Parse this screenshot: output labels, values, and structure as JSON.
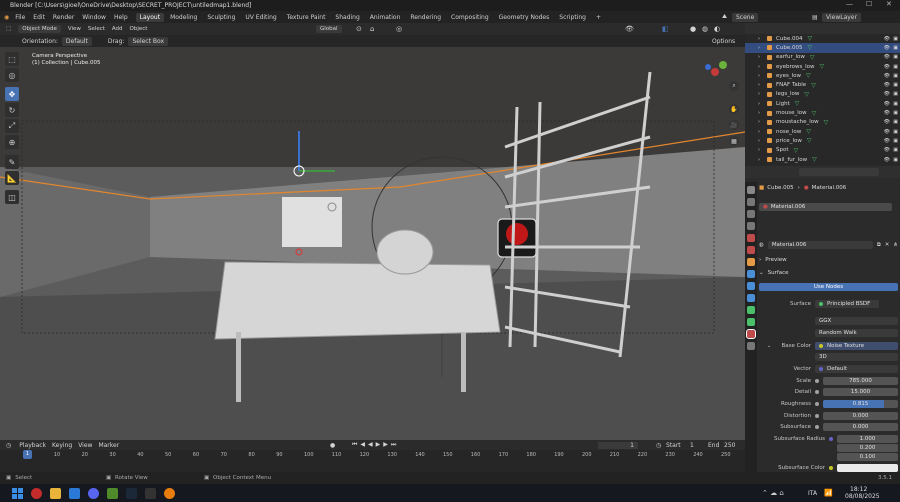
{
  "window": {
    "title": "Blender [C:\\Users\\gioel\\OneDrive\\Desktop\\SECRET_PROJECT\\untiledmap1.blend]",
    "minimize": "—",
    "maximize": "☐",
    "close": "✕"
  },
  "menu": [
    "File",
    "Edit",
    "Render",
    "Window",
    "Help"
  ],
  "workspaces": [
    "Layout",
    "Modeling",
    "Sculpting",
    "UV Editing",
    "Texture Paint",
    "Shading",
    "Animation",
    "Rendering",
    "Compositing",
    "Geometry Nodes",
    "Scripting",
    "+"
  ],
  "scene": {
    "label": "Scene",
    "view_layer": "ViewLayer"
  },
  "viewport_header": {
    "mode": "Object Mode",
    "items": [
      "View",
      "Select",
      "Add",
      "Object"
    ],
    "transform": "Global",
    "orientation_label": "Orientation:",
    "orientation_value": "Default",
    "drag_label": "Drag:",
    "drag_value": "Select Box",
    "options": "Options"
  },
  "viewport": {
    "camera_text": "Camera Perspective",
    "collection_text": "(1) Collection | Cube.005"
  },
  "outliner": {
    "items": [
      {
        "name": "Cube.004",
        "selected": false
      },
      {
        "name": "Cube.005",
        "selected": true
      },
      {
        "name": "earfur_low",
        "selected": false
      },
      {
        "name": "eyebrows_low",
        "selected": false
      },
      {
        "name": "eyes_low",
        "selected": false
      },
      {
        "name": "FNAF Table",
        "selected": false
      },
      {
        "name": "legs_low",
        "selected": false
      },
      {
        "name": "Light",
        "selected": false
      },
      {
        "name": "mouse_low",
        "selected": false
      },
      {
        "name": "moustache_low",
        "selected": false
      },
      {
        "name": "nose_low",
        "selected": false
      },
      {
        "name": "price_low",
        "selected": false
      },
      {
        "name": "Spot",
        "selected": false
      },
      {
        "name": "tail_fur_low",
        "selected": false
      }
    ]
  },
  "properties": {
    "breadcrumb_object": "Cube.005",
    "breadcrumb_sep": "›",
    "breadcrumb_material": "Material.006",
    "slot": "Material.006",
    "material_name": "Material.006",
    "preview_label": "Preview",
    "surface_section": "Surface",
    "use_nodes": "Use Nodes",
    "surface_label": "Surface",
    "surface_value": "Principled BSDF",
    "distribution": "GGX",
    "subsurface_method": "Random Walk",
    "base_color_label": "Base Color",
    "base_color_value": "Noise Texture",
    "noise_dim": "3D",
    "vector_label": "Vector",
    "vector_value": "Default",
    "scale_label": "Scale",
    "scale_value": "785.000",
    "detail_label": "Detail",
    "detail_value": "15.000",
    "roughness_label": "Roughness",
    "roughness_value": "0.815",
    "distortion_label": "Distortion",
    "distortion_value": "0.000",
    "subsurface_label": "Subsurface",
    "subsurface_value": "0.000",
    "subsurface_radius_label": "Subsurface Radius",
    "radius_values": [
      "1.000",
      "0.200",
      "0.100"
    ],
    "subsurface_color_label": "Subsurface Color"
  },
  "timeline": {
    "items": [
      "Playback",
      "Keying",
      "View",
      "Marker"
    ],
    "current_frame": "1",
    "start_label": "Start",
    "start_value": "1",
    "end_label": "End",
    "end_value": "250",
    "ticks": [
      "0",
      "10",
      "20",
      "30",
      "40",
      "50",
      "60",
      "70",
      "80",
      "90",
      "100",
      "110",
      "120",
      "130",
      "140",
      "150",
      "160",
      "170",
      "180",
      "190",
      "200",
      "210",
      "220",
      "230",
      "240",
      "250"
    ],
    "frame_marker": "1"
  },
  "statusbar": {
    "select": "Select",
    "rotate": "Rotate View",
    "context": "Object Context Menu",
    "version": "3.5.1"
  },
  "taskbar": {
    "time": "18:12",
    "date": "08/08/2025",
    "lang": "ITA"
  },
  "colors": {
    "accent": "#4772b3",
    "selection": "#334d80",
    "orange": "#e59a45"
  }
}
